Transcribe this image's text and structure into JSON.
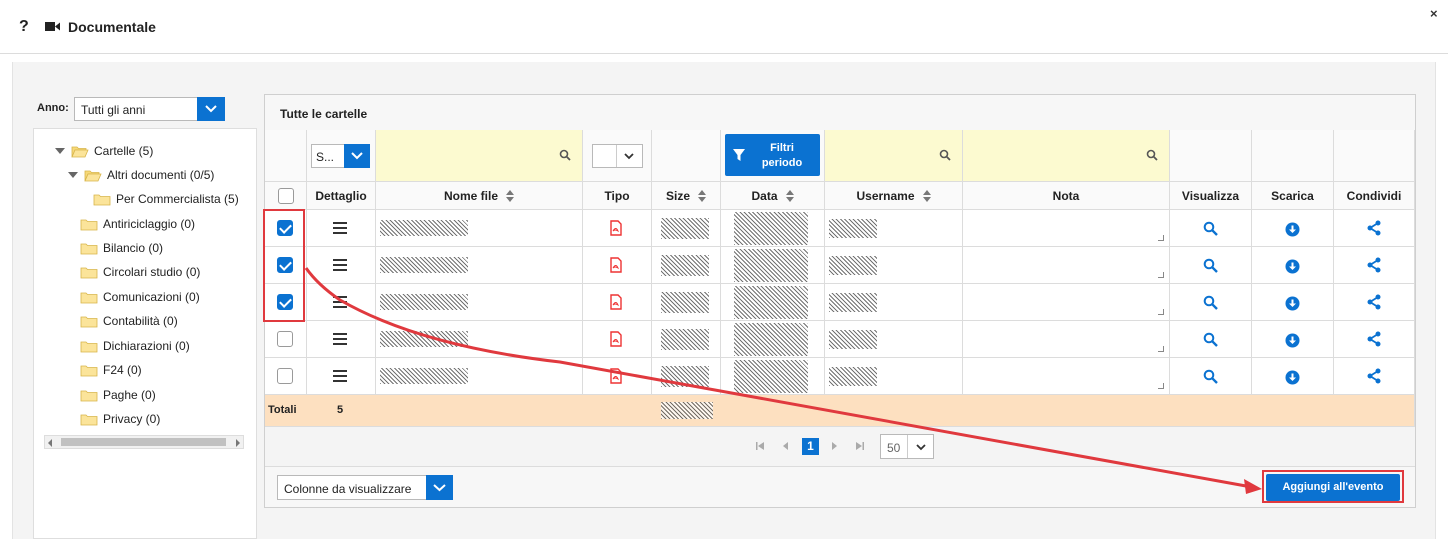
{
  "header": {
    "help_icon_glyph": "?",
    "title": "Documentale",
    "close_glyph": "×"
  },
  "left_panel": {
    "year_label": "Anno:",
    "year_value": "Tutti gli anni",
    "tree": [
      {
        "label": "Cartelle (5)",
        "level": 0,
        "expanded": true
      },
      {
        "label": "Altri documenti (0/5)",
        "level": 1,
        "expanded": true
      },
      {
        "label": "Per Commercialista (5)",
        "level": 2,
        "expanded": false
      },
      {
        "label": "Antiriciclaggio (0)",
        "level": 1,
        "expanded": false
      },
      {
        "label": "Bilancio (0)",
        "level": 1,
        "expanded": false
      },
      {
        "label": "Circolari studio (0)",
        "level": 1,
        "expanded": false
      },
      {
        "label": "Comunicazioni (0)",
        "level": 1,
        "expanded": false
      },
      {
        "label": "Contabilità (0)",
        "level": 1,
        "expanded": false
      },
      {
        "label": "Dichiarazioni (0)",
        "level": 1,
        "expanded": false
      },
      {
        "label": "F24 (0)",
        "level": 1,
        "expanded": false
      },
      {
        "label": "Paghe (0)",
        "level": 1,
        "expanded": false
      },
      {
        "label": "Privacy (0)",
        "level": 1,
        "expanded": false
      }
    ]
  },
  "grid": {
    "title": "Tutte le cartelle",
    "filter_select_value": "S...",
    "period_filter_label_line1": "Filtri",
    "period_filter_label_line2": "periodo",
    "columns": [
      "Dettaglio",
      "Nome file",
      "Tipo",
      "Size",
      "Data",
      "Username",
      "Nota",
      "Visualizza",
      "Scarica",
      "Condividi"
    ],
    "rows": [
      {
        "selected": true
      },
      {
        "selected": true
      },
      {
        "selected": true
      },
      {
        "selected": false
      },
      {
        "selected": false
      }
    ],
    "totals_label": "Totali",
    "totals_count": "5",
    "pager": {
      "current_page": "1",
      "page_size": "50"
    },
    "columns_button": "Colonne da visualizzare",
    "add_button": "Aggiungi all'evento"
  },
  "colors": {
    "accent": "#0b72d1",
    "highlight": "#e0393e",
    "filter_bg": "#fcfad0",
    "totals_bg": "#fde0c0"
  }
}
